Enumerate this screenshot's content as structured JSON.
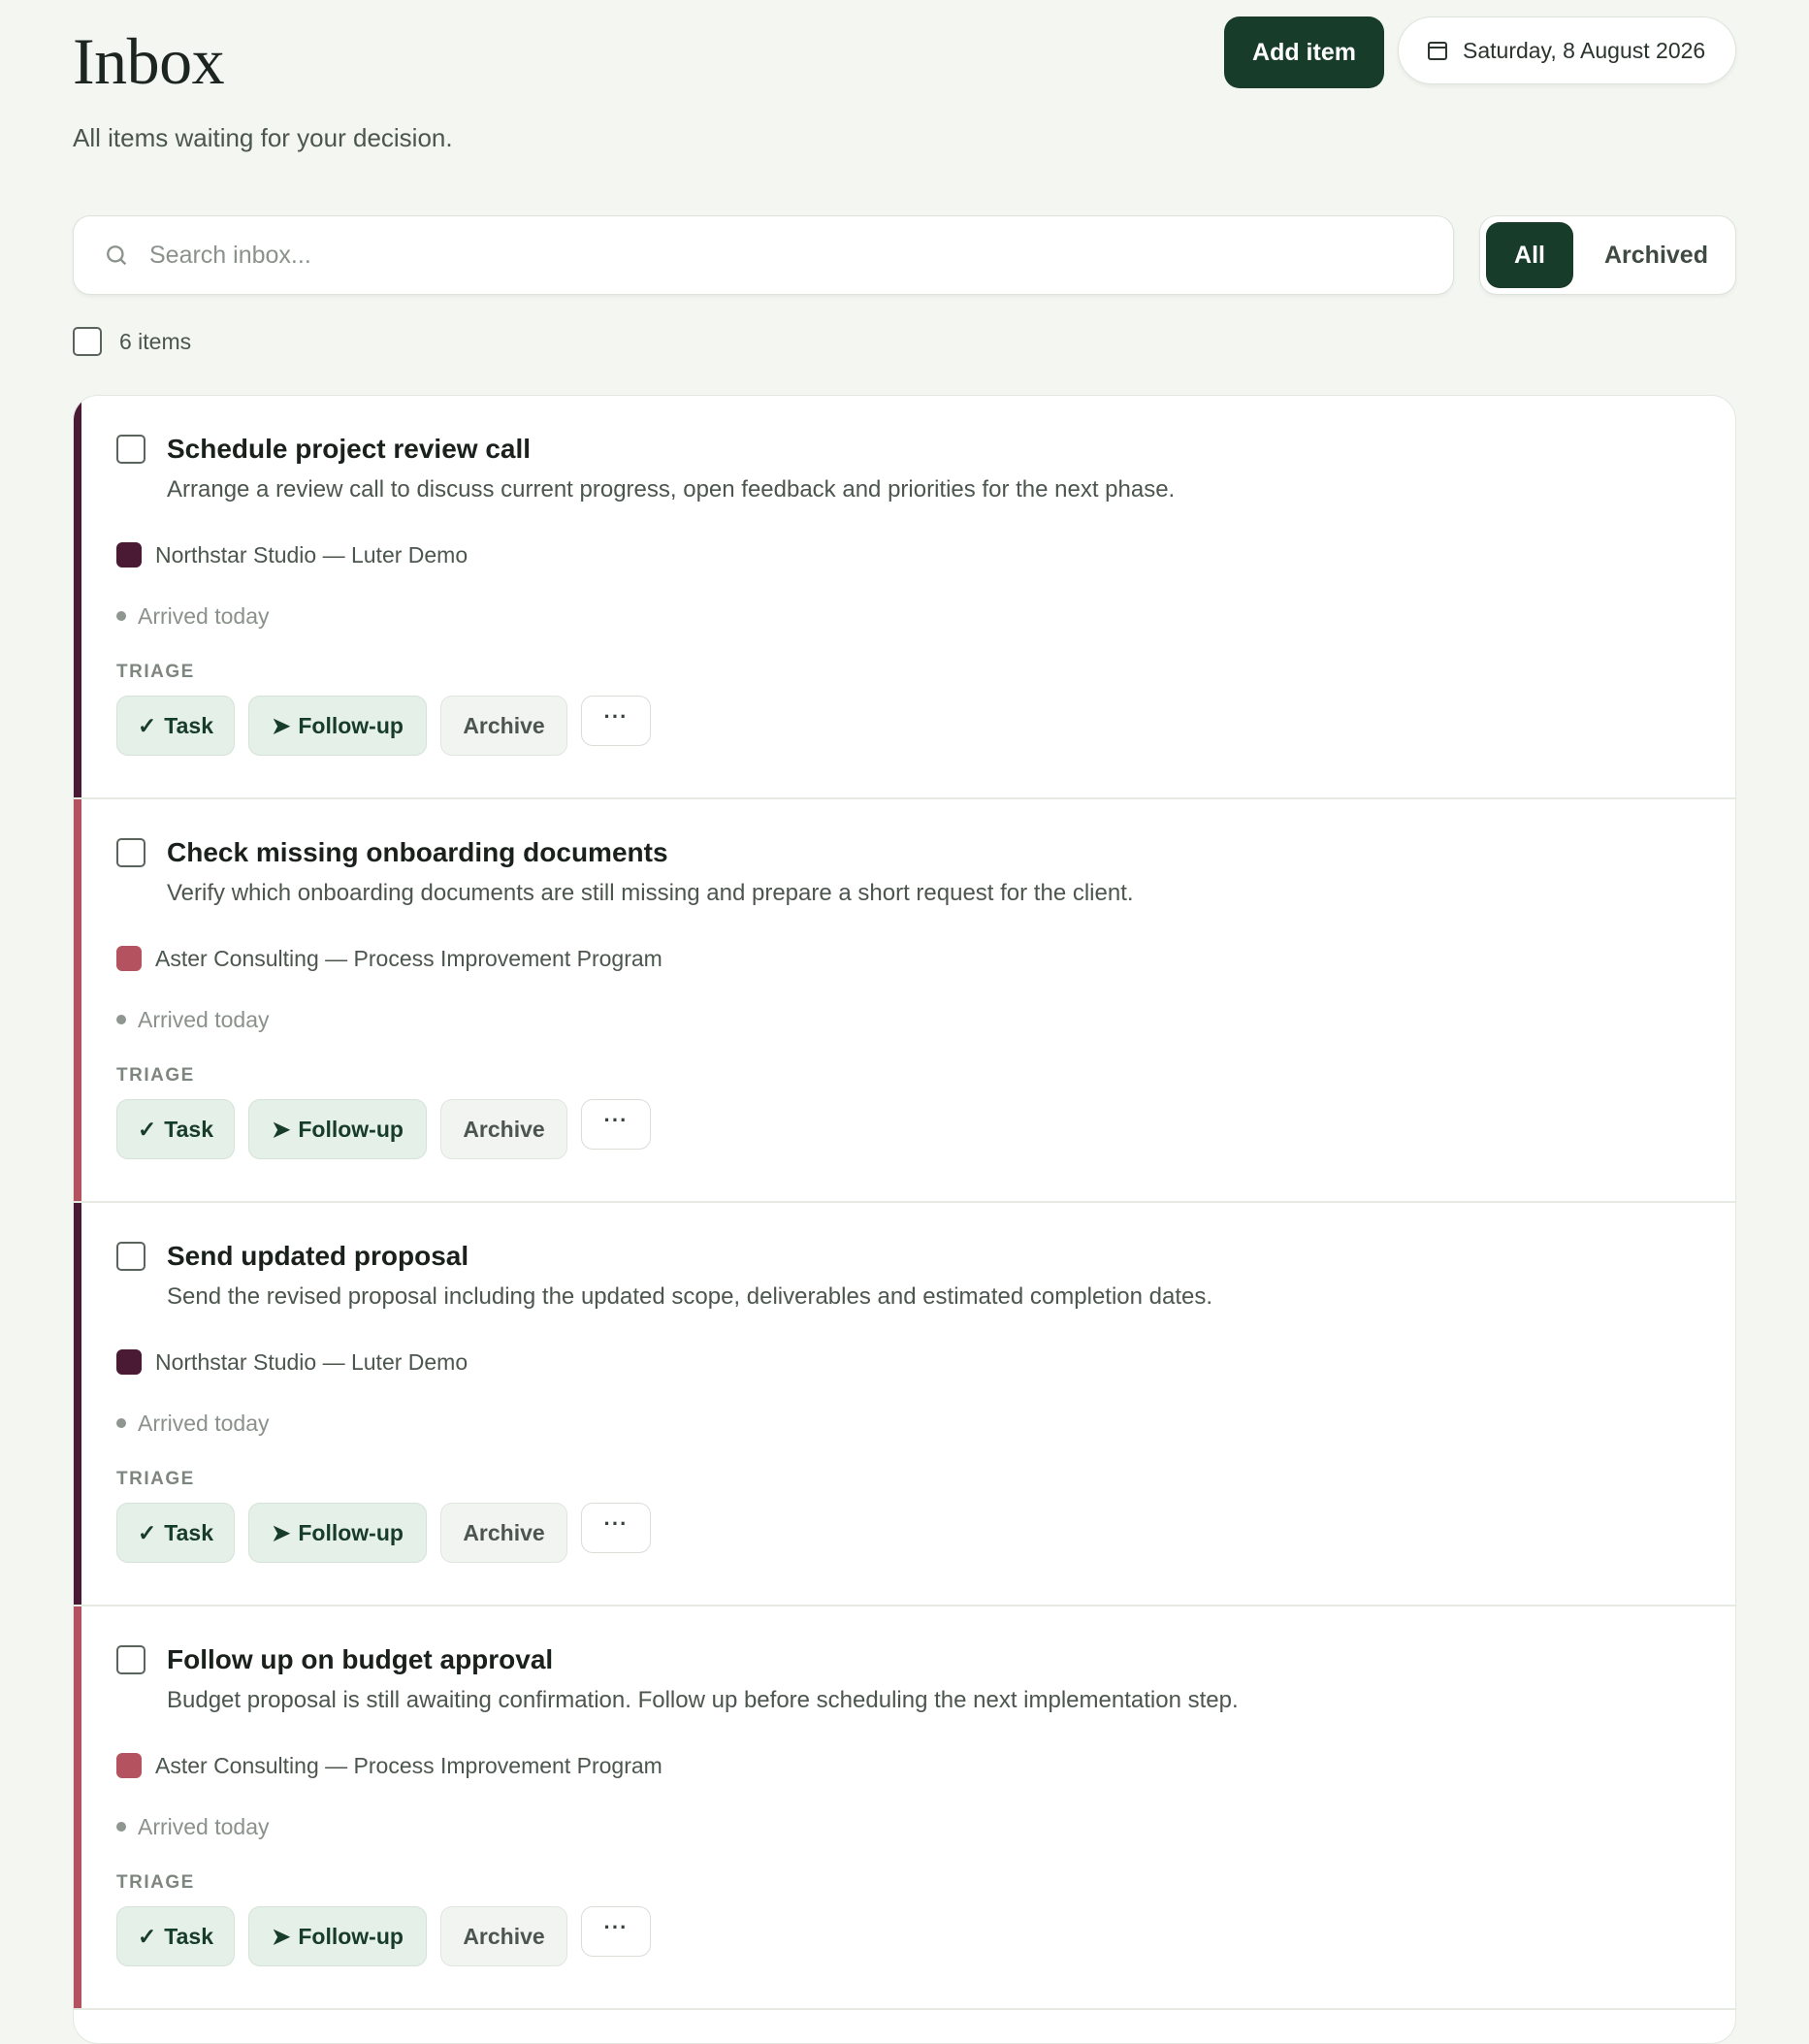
{
  "header": {
    "title": "Inbox",
    "subtitle": "All items waiting for your decision.",
    "add_item_label": "Add item",
    "date": "Saturday, 8 August 2026"
  },
  "search": {
    "placeholder": "Search inbox..."
  },
  "filters": {
    "all_label": "All",
    "archived_label": "Archived",
    "active": "All"
  },
  "selection": {
    "count_label": "6 items"
  },
  "colors": {
    "primary": "#173c29",
    "northstar": "#4a1a35",
    "aster": "#b5525f"
  },
  "items": [
    {
      "title": "Schedule project review call",
      "description": "Arrange a review call to discuss current progress, open feedback and priorities for the next phase.",
      "project": "Northstar Studio — Luter Demo",
      "project_color": "#4a1a35",
      "arrived": "Arrived today",
      "triage_label": "TRIAGE",
      "task_label": "Task",
      "follow_label": "Follow-up",
      "archive_label": "Archive",
      "more_label": "···"
    },
    {
      "title": "Check missing onboarding documents",
      "description": "Verify which onboarding documents are still missing and prepare a short request for the client.",
      "project": "Aster Consulting — Process Improvement Program",
      "project_color": "#b5525f",
      "arrived": "Arrived today",
      "triage_label": "TRIAGE",
      "task_label": "Task",
      "follow_label": "Follow-up",
      "archive_label": "Archive",
      "more_label": "···"
    },
    {
      "title": "Send updated proposal",
      "description": "Send the revised proposal including the updated scope, deliverables and estimated completion dates.",
      "project": "Northstar Studio — Luter Demo",
      "project_color": "#4a1a35",
      "arrived": "Arrived today",
      "triage_label": "TRIAGE",
      "task_label": "Task",
      "follow_label": "Follow-up",
      "archive_label": "Archive",
      "more_label": "···"
    },
    {
      "title": "Follow up on budget approval",
      "description": "Budget proposal is still awaiting confirmation. Follow up before scheduling the next implementation step.",
      "project": "Aster Consulting — Process Improvement Program",
      "project_color": "#b5525f",
      "arrived": "Arrived today",
      "triage_label": "TRIAGE",
      "task_label": "Task",
      "follow_label": "Follow-up",
      "archive_label": "Archive",
      "more_label": "···"
    }
  ]
}
